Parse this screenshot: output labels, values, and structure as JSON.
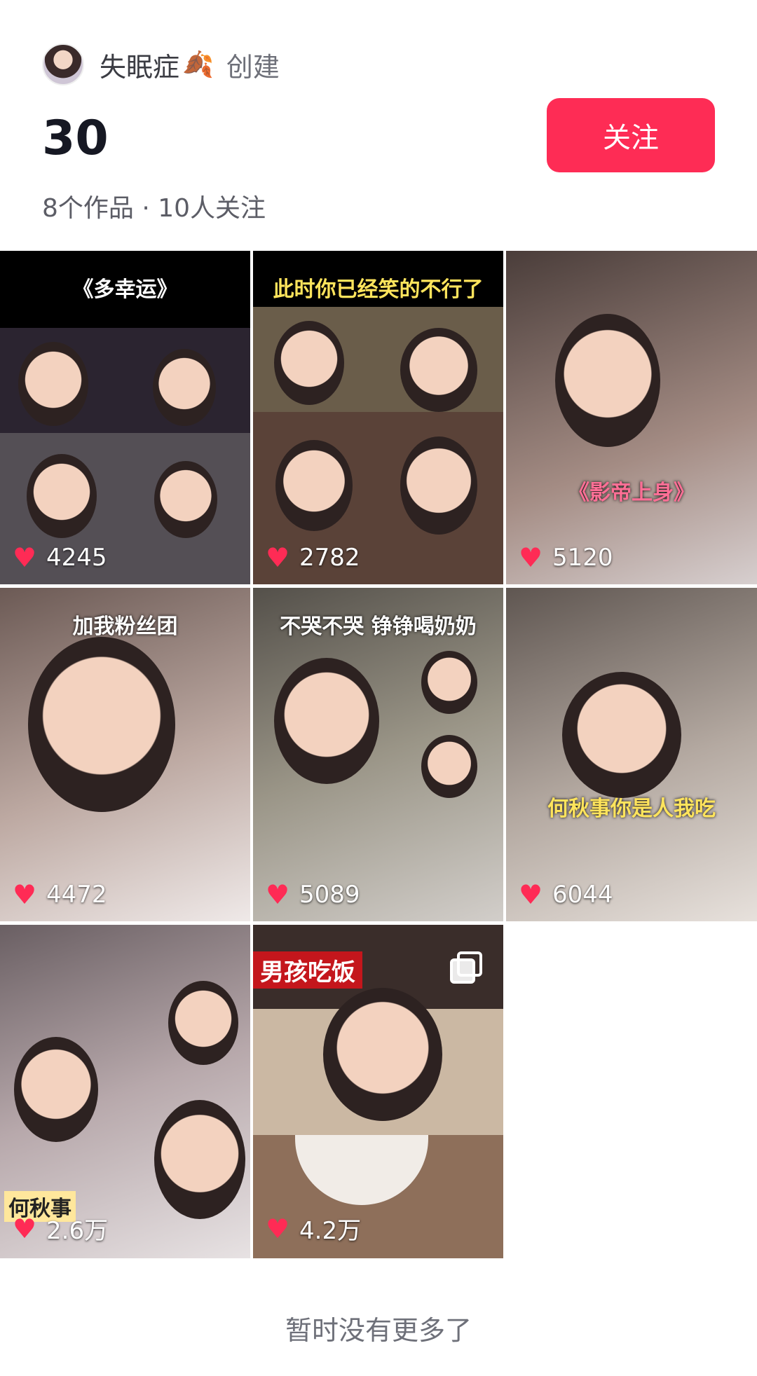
{
  "creator": {
    "name": "失眠症",
    "created_label": "创建"
  },
  "collection": {
    "title": "30",
    "stats": "8个作品 · 10人关注"
  },
  "follow_label": "关注",
  "tiles": [
    {
      "caption": "《多幸运》",
      "likes": "4245"
    },
    {
      "caption": "此时你已经笑的不行了",
      "likes": "2782"
    },
    {
      "caption": "《影帝上身》",
      "likes": "5120"
    },
    {
      "caption": "加我粉丝团",
      "likes": "4472"
    },
    {
      "caption": "不哭不哭 铮铮喝奶奶",
      "likes": "5089"
    },
    {
      "caption": "何秋事你是人我吃",
      "likes": "6044"
    },
    {
      "caption": "何秋事",
      "likes": "2.6万"
    },
    {
      "caption": "男孩吃饭",
      "likes": "4.2万"
    }
  ],
  "footer": "暂时没有更多了"
}
